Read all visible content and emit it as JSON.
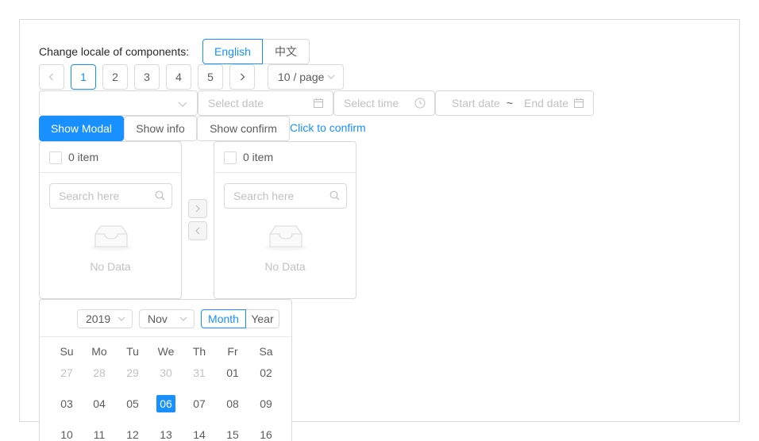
{
  "locale": {
    "label": "Change locale of components:",
    "options": [
      "English",
      "中文"
    ],
    "selected": "English"
  },
  "pagination": {
    "prev_icon": "chevron-left-icon",
    "pages": [
      "1",
      "2",
      "3",
      "4",
      "5"
    ],
    "current": "1",
    "next_icon": "chevron-right-icon",
    "page_size": "10 / page"
  },
  "pickers": {
    "select_value": "",
    "date_placeholder": "Select date",
    "time_placeholder": "Select time",
    "range_start_placeholder": "Start date",
    "range_separator": "~",
    "range_end_placeholder": "End date"
  },
  "actions": {
    "show_modal": "Show Modal",
    "show_info": "Show info",
    "show_confirm": "Show confirm",
    "click_to_confirm": "Click to confirm"
  },
  "transfer": {
    "left": {
      "count_label": "0 item",
      "search_placeholder": "Search here",
      "empty_text": "No Data"
    },
    "right": {
      "count_label": "0 item",
      "search_placeholder": "Search here",
      "empty_text": "No Data"
    },
    "move_right_icon": "chevron-right-icon",
    "move_left_icon": "chevron-left-icon"
  },
  "calendar": {
    "year": "2019",
    "month": "Nov",
    "mode_options": [
      "Month",
      "Year"
    ],
    "mode_selected": "Month",
    "weekdays": [
      "Su",
      "Mo",
      "Tu",
      "We",
      "Th",
      "Fr",
      "Sa"
    ],
    "weeks": [
      [
        {
          "d": "27",
          "m": true
        },
        {
          "d": "28",
          "m": true
        },
        {
          "d": "29",
          "m": true
        },
        {
          "d": "30",
          "m": true
        },
        {
          "d": "31",
          "m": true
        },
        {
          "d": "01"
        },
        {
          "d": "02"
        }
      ],
      [
        {
          "d": "03"
        },
        {
          "d": "04"
        },
        {
          "d": "05"
        },
        {
          "d": "06",
          "s": true
        },
        {
          "d": "07"
        },
        {
          "d": "08"
        },
        {
          "d": "09"
        }
      ],
      [
        {
          "d": "10"
        },
        {
          "d": "11"
        },
        {
          "d": "12"
        },
        {
          "d": "13"
        },
        {
          "d": "14"
        },
        {
          "d": "15"
        },
        {
          "d": "16"
        }
      ]
    ],
    "selected_date": "06"
  },
  "colors": {
    "primary": "#1890ff",
    "border": "#d9d9d9",
    "muted_text": "#bfbfbf"
  }
}
